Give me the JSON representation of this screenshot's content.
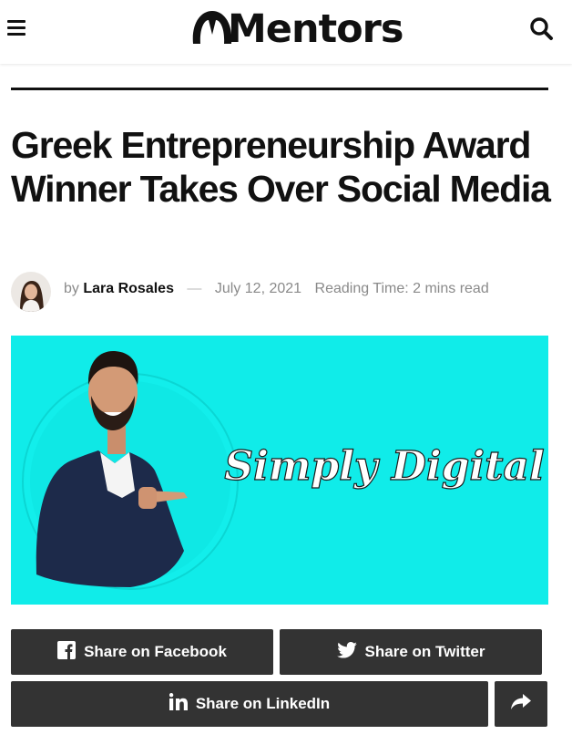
{
  "header": {
    "site_name": "Mentors",
    "menu_icon": "hamburger-menu-icon",
    "search_icon": "search-icon"
  },
  "article": {
    "title": "Greek Entrepreneurship Award Winner Takes Over Social Media",
    "byline_prefix": "by",
    "author": "Lara Rosales",
    "separator": "—",
    "date": "July 12, 2021",
    "reading_time": "Reading Time: 2 mins read",
    "hero_image_text": "Simply Digital"
  },
  "share": {
    "facebook_label": "Share on Facebook",
    "twitter_label": "Share on Twitter",
    "linkedin_label": "Share on LinkedIn",
    "more_icon": "share-arrow-icon"
  },
  "colors": {
    "hero_background": "#10ece9",
    "share_button_bg": "#333333",
    "meta_text": "#8a8a8a"
  }
}
